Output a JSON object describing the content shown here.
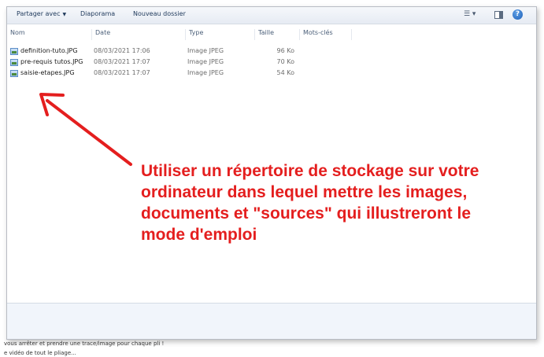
{
  "toolbar": {
    "share_label": "Partager avec",
    "slideshow_label": "Diaporama",
    "new_folder_label": "Nouveau dossier",
    "help_glyph": "?"
  },
  "columns": {
    "name": "Nom",
    "date": "Date",
    "type": "Type",
    "size": "Taille",
    "tags": "Mots-clés"
  },
  "files": [
    {
      "name": "definition-tuto.JPG",
      "date": "08/03/2021 17:06",
      "type": "Image JPEG",
      "size": "96 Ko"
    },
    {
      "name": "pre-requis tutos.JPG",
      "date": "08/03/2021 17:07",
      "type": "Image JPEG",
      "size": "70 Ko"
    },
    {
      "name": "saisie-etapes.JPG",
      "date": "08/03/2021 17:07",
      "type": "Image JPEG",
      "size": "54 Ko"
    }
  ],
  "annotation": {
    "text": "Utiliser un répertoire de stockage sur votre ordinateur dans lequel mettre les images, documents et \"sources\" qui illustreront le mode d'emploi",
    "color": "#e41e1e"
  },
  "background_text": {
    "line1": "vous arrêter et prendre une trace/image pour chaque pli !",
    "line2": "e vidéo de tout le pliage..."
  },
  "icons": {
    "file": "jpeg-file-icon",
    "views": "view-options-icon",
    "preview": "preview-pane-icon",
    "help": "help-icon"
  }
}
